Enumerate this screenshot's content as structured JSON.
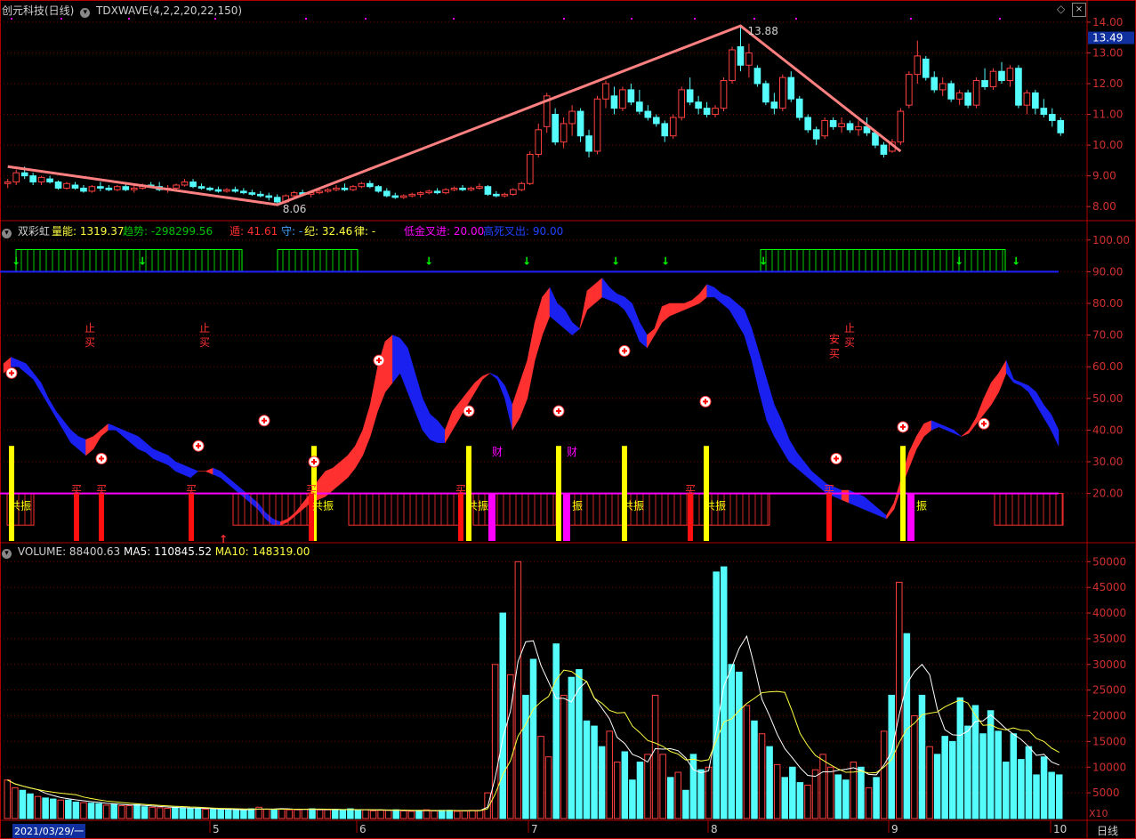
{
  "colors": {
    "bg": "#000000",
    "frame": "#b00000",
    "grid": "#7a0000",
    "axis_text": "#d03030",
    "up": "#ff4040",
    "down": "#54fcfc",
    "wave": "#ff8080",
    "ma5": "#ffffff",
    "ma10": "#ffff40",
    "neon_red": "#ff3030",
    "neon_blue": "#1a20f0",
    "magenta": "#ff00ff",
    "yellow": "#ffff00",
    "green": "#00ff00",
    "blue_line": "#2020ff",
    "label_red": "#ff3030"
  },
  "title_bar": {
    "stock": "创元科技(日线)",
    "indicator": "TDXWAVE(4,2,2,20,22,150)"
  },
  "panel1": {
    "price_label": "13.49",
    "high_label": "13.88",
    "low_label": "8.06"
  },
  "panel2": {
    "name": "双彩虹",
    "legends": [
      {
        "text": "量能: 1319.37",
        "color": "#ffff40"
      },
      {
        "text": "趋势: -298299.56",
        "color": "#00c000"
      },
      {
        "text": "遁: 41.61",
        "color": "#ff3030"
      },
      {
        "text": "守: -",
        "color": "#40a0ff"
      },
      {
        "text": "纪: 32.46",
        "color": "#ffff40"
      },
      {
        "text": "律: -",
        "color": "#ffff40"
      },
      {
        "text": "低金叉进: 20.00",
        "color": "#ff00ff"
      },
      {
        "text": "高死叉出: 90.00",
        "color": "#2040ff"
      }
    ],
    "marks": {
      "zhi": "止",
      "mai": "买",
      "an": "安",
      "cai": "财",
      "maiRed": "买",
      "gongzhen": "共振",
      "zhen": "振"
    }
  },
  "panel3": {
    "name": "VOLUME",
    "legends": [
      {
        "text": "VOLUME: 88400.63",
        "color": "#d0d0d0"
      },
      {
        "text": "MA5: 110845.52",
        "color": "#ffffff"
      },
      {
        "text": "MA10: 148319.00",
        "color": "#ffff40"
      }
    ],
    "unit": "X10"
  },
  "bottom": {
    "date": "2021/03/29/一",
    "months": [
      "5",
      "6",
      "7",
      "8",
      "9",
      "10"
    ],
    "period": "日线"
  },
  "chart_data": [
    {
      "type": "candlestick",
      "title": "创元科技(日线)",
      "ylim": [
        7.6,
        14.2
      ],
      "yticks": [
        8,
        9,
        10,
        11,
        12,
        13,
        14
      ],
      "candles": [
        [
          8.75,
          8.9,
          8.6,
          8.8
        ],
        [
          8.8,
          9.2,
          8.7,
          9.1
        ],
        [
          9.1,
          9.3,
          8.9,
          9.0
        ],
        [
          9.0,
          9.1,
          8.7,
          8.8
        ],
        [
          8.8,
          9.0,
          8.7,
          8.95
        ],
        [
          8.9,
          9.0,
          8.75,
          8.8
        ],
        [
          8.8,
          8.85,
          8.55,
          8.6
        ],
        [
          8.6,
          8.8,
          8.55,
          8.75
        ],
        [
          8.7,
          8.8,
          8.55,
          8.6
        ],
        [
          8.6,
          8.7,
          8.45,
          8.5
        ],
        [
          8.5,
          8.7,
          8.45,
          8.65
        ],
        [
          8.65,
          8.8,
          8.5,
          8.6
        ],
        [
          8.6,
          8.7,
          8.5,
          8.55
        ],
        [
          8.55,
          8.7,
          8.5,
          8.65
        ],
        [
          8.65,
          8.75,
          8.5,
          8.55
        ],
        [
          8.55,
          8.7,
          8.45,
          8.6
        ],
        [
          8.6,
          8.75,
          8.55,
          8.7
        ],
        [
          8.7,
          8.8,
          8.6,
          8.65
        ],
        [
          8.65,
          8.8,
          8.5,
          8.55
        ],
        [
          8.55,
          8.7,
          8.45,
          8.6
        ],
        [
          8.6,
          8.75,
          8.55,
          8.7
        ],
        [
          8.7,
          8.9,
          8.65,
          8.8
        ],
        [
          8.8,
          8.9,
          8.6,
          8.65
        ],
        [
          8.65,
          8.75,
          8.55,
          8.6
        ],
        [
          8.6,
          8.65,
          8.5,
          8.55
        ],
        [
          8.55,
          8.65,
          8.45,
          8.5
        ],
        [
          8.5,
          8.6,
          8.45,
          8.55
        ],
        [
          8.55,
          8.65,
          8.45,
          8.5
        ],
        [
          8.5,
          8.6,
          8.4,
          8.45
        ],
        [
          8.45,
          8.55,
          8.35,
          8.4
        ],
        [
          8.4,
          8.5,
          8.3,
          8.35
        ],
        [
          8.35,
          8.45,
          8.2,
          8.3
        ],
        [
          8.3,
          8.4,
          8.06,
          8.15
        ],
        [
          8.15,
          8.4,
          8.1,
          8.35
        ],
        [
          8.35,
          8.5,
          8.3,
          8.45
        ],
        [
          8.45,
          8.55,
          8.35,
          8.4
        ],
        [
          8.4,
          8.5,
          8.3,
          8.45
        ],
        [
          8.45,
          8.55,
          8.4,
          8.5
        ],
        [
          8.5,
          8.6,
          8.45,
          8.55
        ],
        [
          8.55,
          8.7,
          8.5,
          8.6
        ],
        [
          8.6,
          8.75,
          8.5,
          8.55
        ],
        [
          8.55,
          8.7,
          8.5,
          8.65
        ],
        [
          8.65,
          8.8,
          8.6,
          8.75
        ],
        [
          8.75,
          8.85,
          8.6,
          8.65
        ],
        [
          8.65,
          8.7,
          8.45,
          8.5
        ],
        [
          8.5,
          8.6,
          8.3,
          8.35
        ],
        [
          8.35,
          8.45,
          8.25,
          8.3
        ],
        [
          8.3,
          8.4,
          8.25,
          8.35
        ],
        [
          8.35,
          8.45,
          8.3,
          8.4
        ],
        [
          8.4,
          8.5,
          8.3,
          8.45
        ],
        [
          8.45,
          8.55,
          8.4,
          8.5
        ],
        [
          8.5,
          8.6,
          8.4,
          8.45
        ],
        [
          8.45,
          8.6,
          8.4,
          8.55
        ],
        [
          8.55,
          8.65,
          8.5,
          8.6
        ],
        [
          8.6,
          8.7,
          8.5,
          8.55
        ],
        [
          8.55,
          8.65,
          8.5,
          8.6
        ],
        [
          8.6,
          8.75,
          8.55,
          8.65
        ],
        [
          8.65,
          8.7,
          8.35,
          8.4
        ],
        [
          8.4,
          8.5,
          8.3,
          8.35
        ],
        [
          8.35,
          8.45,
          8.3,
          8.4
        ],
        [
          8.4,
          8.6,
          8.35,
          8.55
        ],
        [
          8.55,
          8.8,
          8.5,
          8.75
        ],
        [
          8.75,
          9.8,
          8.7,
          9.7
        ],
        [
          9.7,
          10.7,
          9.6,
          10.5
        ],
        [
          10.6,
          11.7,
          10.4,
          11.6
        ],
        [
          11.0,
          11.2,
          10.0,
          10.1
        ],
        [
          10.1,
          10.9,
          9.9,
          10.7
        ],
        [
          10.7,
          11.3,
          10.3,
          11.1
        ],
        [
          11.1,
          11.2,
          10.1,
          10.3
        ],
        [
          10.3,
          10.5,
          9.6,
          9.8
        ],
        [
          9.8,
          11.6,
          9.7,
          11.5
        ],
        [
          11.5,
          12.1,
          11.2,
          12.0
        ],
        [
          11.6,
          11.9,
          11.0,
          11.2
        ],
        [
          11.2,
          11.9,
          11.1,
          11.8
        ],
        [
          11.8,
          12.0,
          11.3,
          11.4
        ],
        [
          11.4,
          11.8,
          11.0,
          11.1
        ],
        [
          11.1,
          11.3,
          10.8,
          10.9
        ],
        [
          10.9,
          11.0,
          10.6,
          10.7
        ],
        [
          10.7,
          10.8,
          10.1,
          10.3
        ],
        [
          10.3,
          11.0,
          10.2,
          10.9
        ],
        [
          10.9,
          11.9,
          10.8,
          11.8
        ],
        [
          11.8,
          12.2,
          11.3,
          11.4
        ],
        [
          11.4,
          11.6,
          11.0,
          11.2
        ],
        [
          11.2,
          11.4,
          10.9,
          11.0
        ],
        [
          11.0,
          11.3,
          10.9,
          11.2
        ],
        [
          11.2,
          12.2,
          11.1,
          12.1
        ],
        [
          12.1,
          13.2,
          12.0,
          13.1
        ],
        [
          13.2,
          13.88,
          12.4,
          12.6
        ],
        [
          12.6,
          13.3,
          12.2,
          13.0
        ],
        [
          12.5,
          12.6,
          11.9,
          12.0
        ],
        [
          12.0,
          12.1,
          11.3,
          11.4
        ],
        [
          11.4,
          11.7,
          11.0,
          11.2
        ],
        [
          11.2,
          12.3,
          11.1,
          12.2
        ],
        [
          12.2,
          12.4,
          11.4,
          11.5
        ],
        [
          11.5,
          11.6,
          10.8,
          10.9
        ],
        [
          10.9,
          11.0,
          10.4,
          10.5
        ],
        [
          10.5,
          10.6,
          10.0,
          10.2
        ],
        [
          10.3,
          10.9,
          10.2,
          10.8
        ],
        [
          10.8,
          10.9,
          10.5,
          10.6
        ],
        [
          10.6,
          10.9,
          10.4,
          10.7
        ],
        [
          10.7,
          10.8,
          10.4,
          10.5
        ],
        [
          10.5,
          10.8,
          10.3,
          10.6
        ],
        [
          10.6,
          10.9,
          10.3,
          10.4
        ],
        [
          10.4,
          10.5,
          9.9,
          10.0
        ],
        [
          10.0,
          10.1,
          9.6,
          9.7
        ],
        [
          9.8,
          10.2,
          9.75,
          10.1
        ],
        [
          10.1,
          11.2,
          10.0,
          11.1
        ],
        [
          11.3,
          12.4,
          11.2,
          12.3
        ],
        [
          12.3,
          13.4,
          12.0,
          12.9
        ],
        [
          12.8,
          12.9,
          12.1,
          12.2
        ],
        [
          12.2,
          12.4,
          11.7,
          11.8
        ],
        [
          11.8,
          12.2,
          11.6,
          12.0
        ],
        [
          12.0,
          12.1,
          11.4,
          11.5
        ],
        [
          11.5,
          11.8,
          11.3,
          11.7
        ],
        [
          11.7,
          11.8,
          11.2,
          11.3
        ],
        [
          11.3,
          12.2,
          11.2,
          12.1
        ],
        [
          12.1,
          12.5,
          11.8,
          11.9
        ],
        [
          11.9,
          12.5,
          11.8,
          12.4
        ],
        [
          12.4,
          12.7,
          12.0,
          12.1
        ],
        [
          12.1,
          12.6,
          11.9,
          12.5
        ],
        [
          12.5,
          12.6,
          11.2,
          11.3
        ],
        [
          11.3,
          11.8,
          11.0,
          11.7
        ],
        [
          11.7,
          11.8,
          11.0,
          11.2
        ],
        [
          11.2,
          11.5,
          10.9,
          11.0
        ],
        [
          11.0,
          11.2,
          10.6,
          10.8
        ],
        [
          10.8,
          10.9,
          10.3,
          10.4
        ]
      ]
    },
    {
      "type": "area",
      "title": "双彩虹",
      "ylim": [
        5,
        105
      ],
      "yticks": [
        20,
        30,
        40,
        50,
        60,
        70,
        80,
        90,
        100
      ],
      "upper": [
        61,
        63,
        62,
        61,
        58,
        55,
        50,
        46,
        43,
        40,
        38,
        37,
        38,
        40,
        42,
        41,
        40,
        39,
        38,
        36,
        34,
        33,
        32,
        30,
        29,
        28,
        27,
        27,
        28,
        27,
        25,
        23,
        21,
        19,
        17,
        14,
        12,
        11,
        12,
        14,
        17,
        20,
        24,
        27,
        28,
        30,
        32,
        35,
        40,
        48,
        60,
        68,
        70,
        69,
        66,
        58,
        50,
        45,
        43,
        40,
        46,
        49,
        52,
        55,
        57,
        58,
        57,
        54,
        48,
        55,
        62,
        74,
        82,
        85,
        80,
        78,
        74,
        72,
        84,
        86,
        88,
        85,
        83,
        82,
        80,
        74,
        70,
        72,
        79,
        80,
        80,
        80,
        81,
        83,
        86,
        85,
        83,
        82,
        80,
        78,
        72,
        64,
        56,
        48,
        43,
        37,
        33,
        30,
        27,
        25,
        23,
        22,
        21,
        21,
        20,
        19,
        17,
        15,
        13,
        17,
        25,
        33,
        38,
        42,
        43,
        42,
        41,
        40,
        38,
        40,
        44,
        50,
        55,
        58,
        62,
        56,
        55,
        54,
        52,
        48,
        45,
        40
      ],
      "lower": [
        58,
        60,
        60,
        58,
        56,
        52,
        48,
        44,
        40,
        36,
        34,
        32,
        34,
        38,
        40,
        40,
        38,
        36,
        34,
        33,
        31,
        30,
        29,
        27,
        26,
        25,
        27,
        27,
        26,
        25,
        23,
        21,
        19,
        17,
        15,
        12,
        10,
        10,
        11,
        13,
        15,
        17,
        18,
        19,
        21,
        23,
        25,
        28,
        32,
        38,
        46,
        52,
        55,
        58,
        52,
        46,
        40,
        37,
        36,
        36,
        40,
        44,
        48,
        52,
        56,
        58,
        56,
        50,
        40,
        44,
        50,
        62,
        70,
        76,
        74,
        72,
        70,
        72,
        78,
        80,
        82,
        81,
        80,
        78,
        74,
        68,
        66,
        70,
        74,
        76,
        77,
        78,
        79,
        80,
        82,
        82,
        80,
        78,
        74,
        70,
        62,
        52,
        43,
        38,
        34,
        30,
        28,
        26,
        24,
        22,
        20,
        19,
        18,
        17,
        16,
        15,
        14,
        13,
        12,
        15,
        22,
        28,
        34,
        38,
        40,
        41,
        40,
        39,
        38,
        39,
        42,
        45,
        48,
        52,
        58,
        55,
        54,
        52,
        48,
        44,
        40,
        35
      ]
    },
    {
      "type": "bar",
      "title": "VOLUME",
      "ylim": [
        0,
        53000
      ],
      "yticks": [
        5000,
        10000,
        15000,
        20000,
        25000,
        30000,
        35000,
        40000,
        45000,
        50000
      ],
      "values": [
        7500,
        6000,
        5500,
        4800,
        4300,
        4000,
        3800,
        3600,
        3600,
        3200,
        3100,
        3000,
        2900,
        2600,
        2800,
        2500,
        2500,
        2700,
        2300,
        2200,
        2100,
        2000,
        2200,
        2100,
        1900,
        2000,
        1800,
        1800,
        1700,
        1800,
        1700,
        1600,
        1900,
        2200,
        1800,
        1800,
        1900,
        1700,
        1700,
        1800,
        1900,
        1700,
        1700,
        1800,
        1600,
        1900,
        1600,
        1700,
        1500,
        1600,
        1600,
        1700,
        1500,
        1400,
        1500,
        1700,
        1500,
        1600,
        1600,
        1400,
        1500,
        1600,
        1600,
        5000,
        30000,
        40000,
        28000,
        50000,
        24000,
        31000,
        16000,
        12000,
        34000,
        24000,
        27500,
        29000,
        19000,
        18000,
        14000,
        17000,
        11000,
        13000,
        7500,
        11000,
        12500,
        24000,
        12500,
        8000,
        9000,
        5500,
        12500,
        9500,
        10000,
        48000,
        49000,
        30000,
        28500,
        22000,
        19000,
        16500,
        14000,
        10500,
        8000,
        10000,
        7000,
        6500,
        9500,
        12500,
        10000,
        8500,
        7500,
        11000,
        10000,
        6000,
        8000,
        17000,
        24000,
        46000,
        36000,
        20000,
        24000,
        14000,
        12500,
        16000,
        15000,
        23500,
        18000,
        22000,
        16500,
        21000,
        17000,
        11000,
        16500,
        11500,
        14000,
        8500,
        12000,
        9000,
        8500
      ]
    }
  ]
}
